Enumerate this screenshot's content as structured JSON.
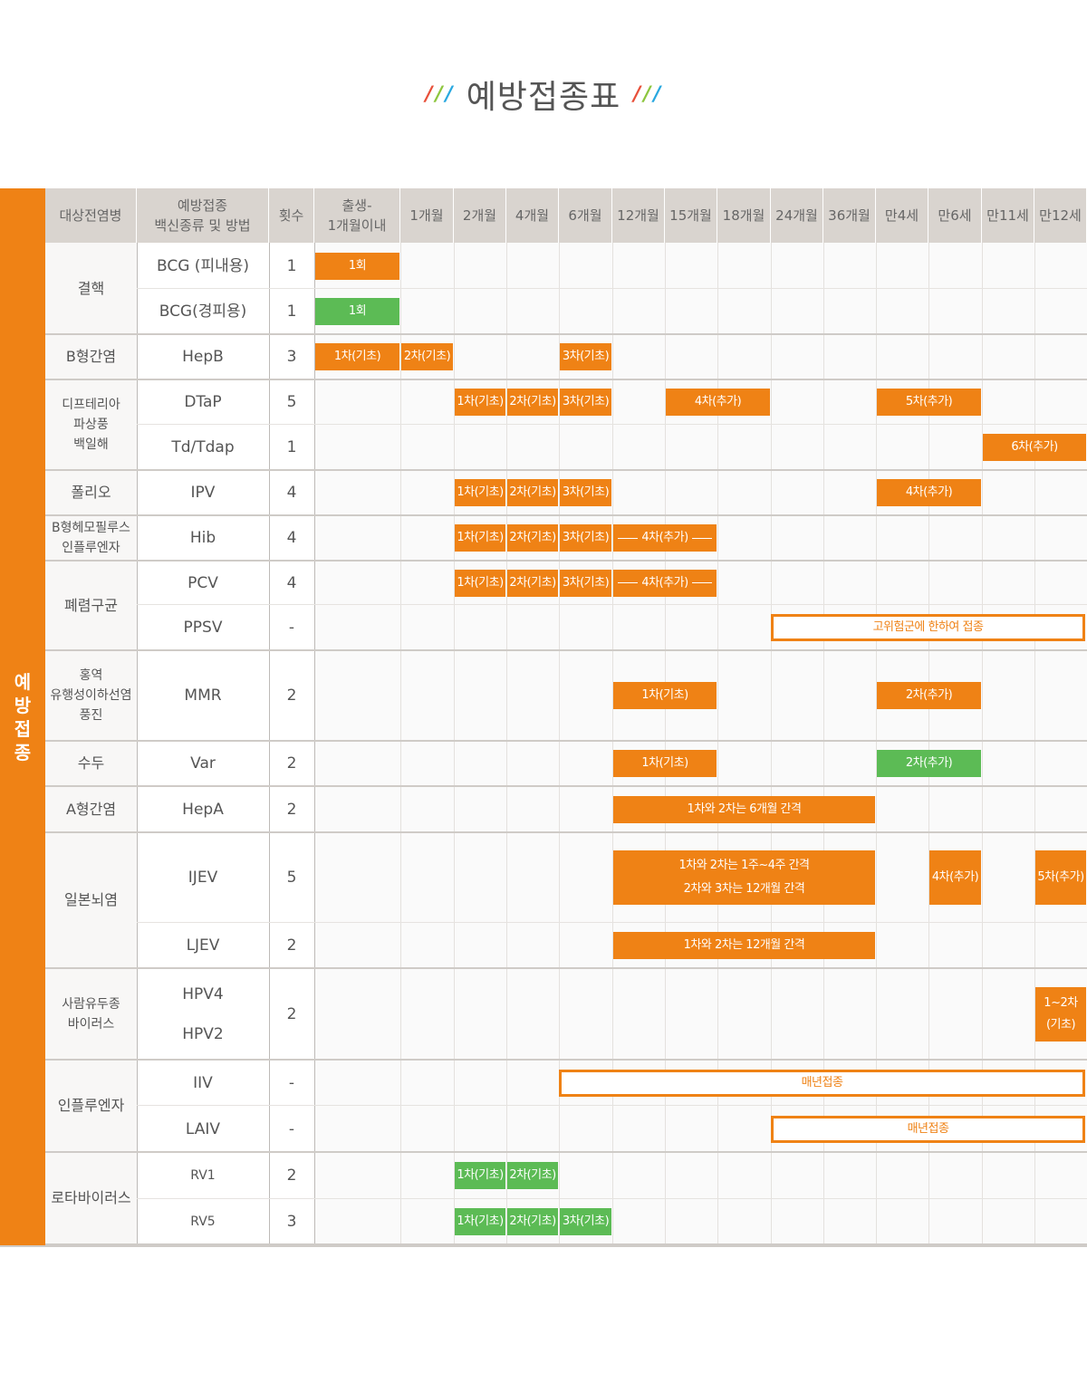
{
  "page": {
    "title": "예방접종표",
    "side_label": "예방접종",
    "colors": {
      "orange": "#ef8215",
      "green": "#5cbb55",
      "header_bg": "#d9d4cf"
    }
  },
  "header": {
    "disease": "대상전염병",
    "vaccine": "예방접종\n백신종류 및 방법",
    "count": "횟수",
    "ages": [
      "출생-\n1개월이내",
      "1개월",
      "2개월",
      "4개월",
      "6개월",
      "12개월",
      "15개월",
      "18개월",
      "24개월",
      "36개월",
      "만4세",
      "만6세",
      "만11세",
      "만12세"
    ]
  },
  "diseases": [
    "결핵",
    "B형간염",
    "디프테리아\n파상풍\n백일해",
    "폴리오",
    "B형헤모필루스\n인플루엔자",
    "폐렴구균",
    "홍역\n유행성이하선염\n풍진",
    "수두",
    "A형간염",
    "일본뇌염",
    "사람유두종\n바이러스",
    "인플루엔자",
    "로타바이러스"
  ],
  "rows": [
    {
      "vaccine": "BCG (피내용)",
      "count": "1"
    },
    {
      "vaccine": "BCG(경피용)",
      "count": "1"
    },
    {
      "vaccine": "HepB",
      "count": "3"
    },
    {
      "vaccine": "DTaP",
      "count": "5"
    },
    {
      "vaccine": "Td/Tdap",
      "count": "1"
    },
    {
      "vaccine": "IPV",
      "count": "4"
    },
    {
      "vaccine": "Hib",
      "count": "4"
    },
    {
      "vaccine": "PCV",
      "count": "4"
    },
    {
      "vaccine": "PPSV",
      "count": "-"
    },
    {
      "vaccine": "MMR",
      "count": "2"
    },
    {
      "vaccine": "Var",
      "count": "2"
    },
    {
      "vaccine": "HepA",
      "count": "2"
    },
    {
      "vaccine": "IJEV",
      "count": "5"
    },
    {
      "vaccine": "LJEV",
      "count": "2"
    },
    {
      "vaccine": "HPV4\n\nHPV2",
      "count": "2"
    },
    {
      "vaccine": "IIV",
      "count": "-"
    },
    {
      "vaccine": "LAIV",
      "count": "-"
    },
    {
      "vaccine": "RV1",
      "count": "2"
    },
    {
      "vaccine": "RV5",
      "count": "3"
    }
  ],
  "bars": [
    {
      "row": 0,
      "from": 0,
      "to": 0,
      "style": "o",
      "label": "1회"
    },
    {
      "row": 1,
      "from": 0,
      "to": 0,
      "style": "g",
      "label": "1회"
    },
    {
      "row": 2,
      "from": 0,
      "to": 0,
      "style": "o",
      "label": "1차(기초)"
    },
    {
      "row": 2,
      "from": 1,
      "to": 1,
      "style": "o",
      "label": "2차(기초)"
    },
    {
      "row": 2,
      "from": 4,
      "to": 4,
      "style": "o",
      "label": "3차(기초)"
    },
    {
      "row": 3,
      "from": 2,
      "to": 2,
      "style": "o",
      "label": "1차(기초)"
    },
    {
      "row": 3,
      "from": 3,
      "to": 3,
      "style": "o",
      "label": "2차(기초)"
    },
    {
      "row": 3,
      "from": 4,
      "to": 4,
      "style": "o",
      "label": "3차(기초)"
    },
    {
      "row": 3,
      "from": 6,
      "to": 7,
      "style": "o",
      "label": "4차(추가)"
    },
    {
      "row": 3,
      "from": 10,
      "to": 11,
      "style": "o",
      "label": "5차(추가)"
    },
    {
      "row": 4,
      "from": 12,
      "to": 13,
      "style": "o",
      "label": "6차(추가)"
    },
    {
      "row": 5,
      "from": 2,
      "to": 2,
      "style": "o",
      "label": "1차(기초)"
    },
    {
      "row": 5,
      "from": 3,
      "to": 3,
      "style": "o",
      "label": "2차(기초)"
    },
    {
      "row": 5,
      "from": 4,
      "to": 4,
      "style": "o",
      "label": "3차(기초)"
    },
    {
      "row": 5,
      "from": 10,
      "to": 11,
      "style": "o",
      "label": "4차(추가)"
    },
    {
      "row": 6,
      "from": 2,
      "to": 2,
      "style": "o",
      "label": "1차(기초)"
    },
    {
      "row": 6,
      "from": 3,
      "to": 3,
      "style": "o",
      "label": "2차(기초)"
    },
    {
      "row": 6,
      "from": 4,
      "to": 4,
      "style": "o",
      "label": "3차(기초)"
    },
    {
      "row": 6,
      "from": 5,
      "to": 6,
      "style": "o",
      "label": "4차(추가)",
      "arrows": true
    },
    {
      "row": 7,
      "from": 2,
      "to": 2,
      "style": "o",
      "label": "1차(기초)"
    },
    {
      "row": 7,
      "from": 3,
      "to": 3,
      "style": "o",
      "label": "2차(기초)"
    },
    {
      "row": 7,
      "from": 4,
      "to": 4,
      "style": "o",
      "label": "3차(기초)"
    },
    {
      "row": 7,
      "from": 5,
      "to": 6,
      "style": "o",
      "label": "4차(추가)",
      "arrows": true
    },
    {
      "row": 8,
      "from": 8,
      "to": 13,
      "style": "outline",
      "label": "고위험군에 한하여 접종"
    },
    {
      "row": 9,
      "from": 5,
      "to": 6,
      "style": "o",
      "label": "1차(기초)"
    },
    {
      "row": 9,
      "from": 10,
      "to": 11,
      "style": "o",
      "label": "2차(추가)"
    },
    {
      "row": 10,
      "from": 5,
      "to": 6,
      "style": "o",
      "label": "1차(기초)"
    },
    {
      "row": 10,
      "from": 10,
      "to": 11,
      "style": "g",
      "label": "2차(추가)"
    },
    {
      "row": 11,
      "from": 5,
      "to": 9,
      "style": "o",
      "label": "1차와 2차는 6개월 간격"
    },
    {
      "row": 12,
      "from": 5,
      "to": 9,
      "style": "o",
      "label": "1차와 2차는 1주~4주 간격\n2차와 3차는 12개월 간격"
    },
    {
      "row": 12,
      "from": 11,
      "to": 11,
      "style": "o",
      "label": "4차(추가)"
    },
    {
      "row": 12,
      "from": 13,
      "to": 13,
      "style": "o",
      "label": "5차(추가)"
    },
    {
      "row": 13,
      "from": 5,
      "to": 9,
      "style": "o",
      "label": "1차와 2차는 12개월 간격"
    },
    {
      "row": 14,
      "from": 13,
      "to": 13,
      "style": "o",
      "label": "1~2차\n(기초)"
    },
    {
      "row": 15,
      "from": 4,
      "to": 13,
      "style": "outline",
      "label": "매년접종"
    },
    {
      "row": 16,
      "from": 8,
      "to": 13,
      "style": "outline",
      "label": "매년접종"
    },
    {
      "row": 17,
      "from": 2,
      "to": 2,
      "style": "g",
      "label": "1차(기초)"
    },
    {
      "row": 17,
      "from": 3,
      "to": 3,
      "style": "g",
      "label": "2차(기초)"
    },
    {
      "row": 18,
      "from": 2,
      "to": 2,
      "style": "g",
      "label": "1차(기초)"
    },
    {
      "row": 18,
      "from": 3,
      "to": 3,
      "style": "g",
      "label": "2차(기초)"
    },
    {
      "row": 18,
      "from": 4,
      "to": 4,
      "style": "g",
      "label": "3차(기초)"
    }
  ]
}
